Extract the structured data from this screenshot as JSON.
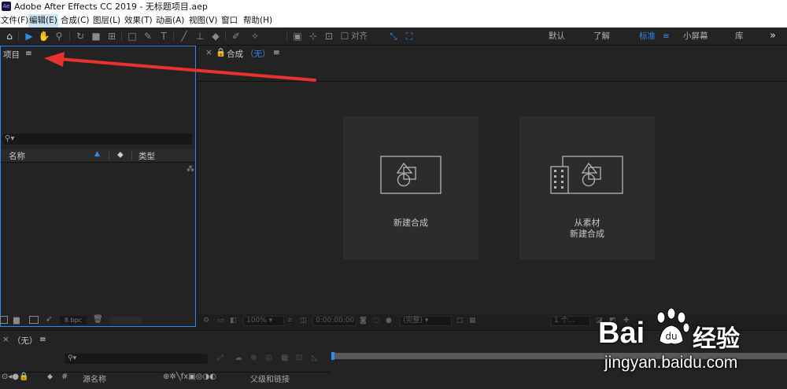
{
  "titlebar": {
    "logo": "Ae",
    "title": "Adobe After Effects CC 2019 - 无标题项目.aep"
  },
  "menu": [
    "文件(F)",
    "编辑(E)",
    "合成(C)",
    "图层(L)",
    "效果(T)",
    "动画(A)",
    "视图(V)",
    "窗口",
    "帮助(H)"
  ],
  "toolbar": {
    "align_label": "对齐",
    "workspaces": [
      "默认",
      "了解",
      "标准",
      "小屏幕",
      "库"
    ],
    "active_workspace": "标准",
    "menu_glyph": "≡",
    "more_glyph": "»"
  },
  "project": {
    "title": "项目",
    "menu_glyph": "≡",
    "columns": {
      "name": "名称",
      "type": "类型"
    },
    "bpc": "8 bpc"
  },
  "viewer": {
    "tab_prefix": "合成",
    "tab_value": "（无）",
    "menu_glyph": "≡",
    "new_comp_label": "新建合成",
    "from_footage_line1": "从素材",
    "from_footage_line2": "新建合成",
    "zoom": "100%",
    "timecode": "0:00:00:00",
    "resolution": "(完整)",
    "views": "1 个..."
  },
  "timeline": {
    "tab_label": "（无）",
    "menu_glyph": "≡",
    "hash": "#",
    "source_name": "源名称",
    "parent_link": "父级和链接"
  },
  "watermark": {
    "brand": "Bai",
    "brand_cn": "经验",
    "url": "jingyan.baidu.com"
  },
  "colors": {
    "accent": "#2d8ceb",
    "arrow": "#e8322f",
    "panel": "#232323",
    "card": "#2c2c2c"
  }
}
